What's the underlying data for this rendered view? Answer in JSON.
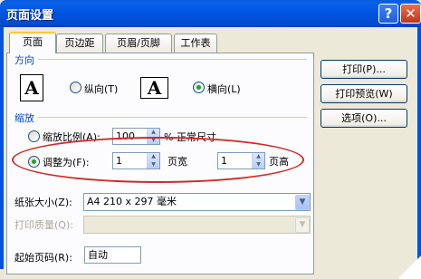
{
  "window": {
    "title": "页面设置",
    "help_glyph": "?",
    "close_glyph": "✕"
  },
  "tabs": [
    {
      "label": "页面",
      "active": true
    },
    {
      "label": "页边距",
      "active": false
    },
    {
      "label": "页眉/页脚",
      "active": false
    },
    {
      "label": "工作表",
      "active": false
    }
  ],
  "orientation": {
    "group_label": "方向",
    "portrait": {
      "label": "纵向",
      "key": "(T)",
      "icon": "A",
      "selected": false
    },
    "landscape": {
      "label": "横向",
      "key": "(L)",
      "icon": "A",
      "selected": true
    }
  },
  "scaling": {
    "group_label": "缩放",
    "adjust_to": {
      "label": "缩放比例",
      "key": "(A)",
      "value": "100",
      "suffix": "% 正常尺寸",
      "selected": false
    },
    "fit_to": {
      "label": "调整为",
      "key": "(F)",
      "selected": true,
      "pages_wide": "1",
      "pages_wide_label": "页宽",
      "pages_tall": "1",
      "pages_tall_label": "页高"
    }
  },
  "paper": {
    "size_label": "纸张大小",
    "size_key": "(Z)",
    "size_value": "A4 210 x 297 毫米",
    "quality_label": "打印质量",
    "quality_key": "(Q)",
    "quality_value": ""
  },
  "first_page": {
    "label": "起始页码",
    "key": "(R)",
    "value": "自动"
  },
  "buttons": {
    "print": "打印(P)...",
    "preview": "打印预览(W)",
    "options": "选项(O)..."
  },
  "colors": {
    "highlight_ellipse": "#d02a2a",
    "group_label": "#0046d5",
    "titlebar": "#0053e0"
  }
}
